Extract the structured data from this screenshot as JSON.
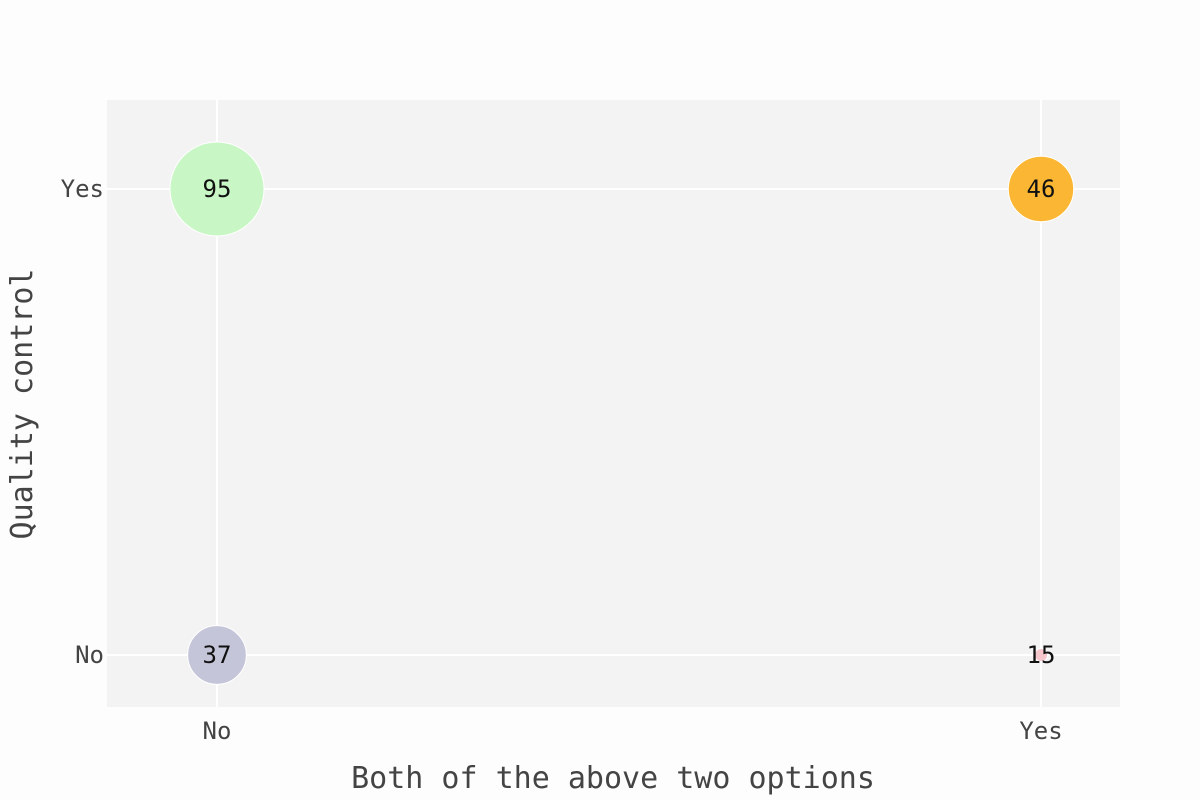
{
  "chart_data": {
    "type": "scatter",
    "subtype": "bubble",
    "xlabel": "Both of the above two options",
    "ylabel": "Quality control",
    "x_categories": [
      "No",
      "Yes"
    ],
    "y_categories": [
      "No",
      "Yes"
    ],
    "grid": true,
    "legend": "none",
    "points": [
      {
        "x": "No",
        "y": "Yes",
        "value": 95,
        "label": "95",
        "color": "#c8f7c5"
      },
      {
        "x": "Yes",
        "y": "Yes",
        "value": 46,
        "label": "46",
        "color": "#fbb734"
      },
      {
        "x": "No",
        "y": "No",
        "value": 37,
        "label": "37",
        "color": "#c5c5d9"
      },
      {
        "x": "Yes",
        "y": "No",
        "value": 15,
        "label": "15",
        "color": "#f5c6cb"
      }
    ]
  },
  "colors": {
    "plot_background": "#f3f3f3",
    "page_background": "#fdfdfd",
    "grid": "#ffffff",
    "bubble_outline": "#ffffff"
  }
}
